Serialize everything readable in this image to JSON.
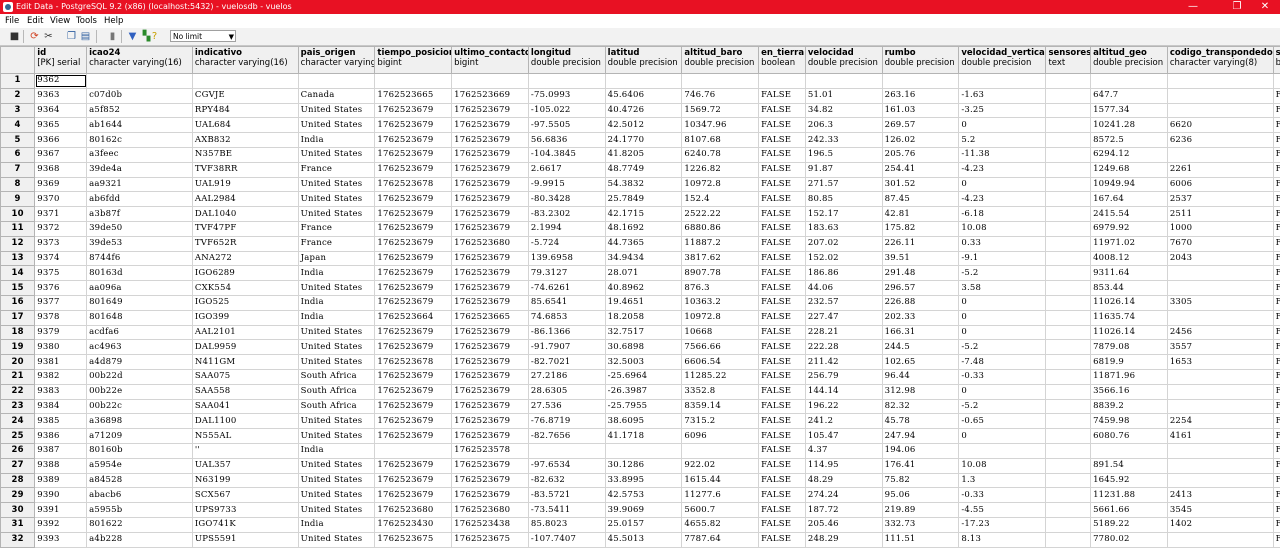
{
  "window": {
    "title": "Edit Data - PostgreSQL 9.2 (x86) (localhost:5432) - vuelosdb - vuelos",
    "minimize": "—",
    "maximize": "❐",
    "close": "✕"
  },
  "menu": [
    "File",
    "Edit",
    "View",
    "Tools",
    "Help"
  ],
  "toolbar": {
    "limit": "No limit"
  },
  "columns": [
    {
      "name": "id",
      "type": "[PK] serial"
    },
    {
      "name": "icao24",
      "type": "character varying(16)"
    },
    {
      "name": "indicativo",
      "type": "character varying(16)"
    },
    {
      "name": "pais_origen",
      "type": "character varying(64)"
    },
    {
      "name": "tiempo_posicion",
      "type": "bigint"
    },
    {
      "name": "ultimo_contacto",
      "type": "bigint"
    },
    {
      "name": "longitud",
      "type": "double precision"
    },
    {
      "name": "latitud",
      "type": "double precision"
    },
    {
      "name": "altitud_baro",
      "type": "double precision"
    },
    {
      "name": "en_tierra",
      "type": "boolean"
    },
    {
      "name": "velocidad",
      "type": "double precision"
    },
    {
      "name": "rumbo",
      "type": "double precision"
    },
    {
      "name": "velocidad_vertical",
      "type": "double precision"
    },
    {
      "name": "sensores",
      "type": "text"
    },
    {
      "name": "altitud_geo",
      "type": "double precision"
    },
    {
      "name": "codigo_transpondedor",
      "type": "character varying(8)"
    },
    {
      "name": "spi",
      "type": "bool"
    }
  ],
  "rows": [
    [
      "9362",
      "",
      "",
      "",
      "",
      "",
      "",
      "",
      "",
      "",
      "",
      "",
      "",
      "",
      "",
      "",
      ""
    ],
    [
      "9363",
      "c07d0b",
      "CGVJE",
      "Canada",
      "1762523665",
      "1762523669",
      "-75.0993",
      "45.6406",
      "746.76",
      "FALSE",
      "51.01",
      "263.16",
      "-1.63",
      "",
      "647.7",
      "",
      "FAL"
    ],
    [
      "9364",
      "a5f852",
      "RPY484",
      "United States",
      "1762523679",
      "1762523679",
      "-105.022",
      "40.4726",
      "1569.72",
      "FALSE",
      "34.82",
      "161.03",
      "-3.25",
      "",
      "1577.34",
      "",
      "FAL"
    ],
    [
      "9365",
      "ab1644",
      "UAL684",
      "United States",
      "1762523679",
      "1762523679",
      "-97.5505",
      "42.5012",
      "10347.96",
      "FALSE",
      "206.3",
      "269.57",
      "0",
      "",
      "10241.28",
      "6620",
      "FAL"
    ],
    [
      "9366",
      "80162c",
      "AXB832",
      "India",
      "1762523679",
      "1762523679",
      "56.6836",
      "24.1770",
      "8107.68",
      "FALSE",
      "242.33",
      "126.02",
      "5.2",
      "",
      "8572.5",
      "6236",
      "FAL"
    ],
    [
      "9367",
      "a3feec",
      "N357BE",
      "United States",
      "1762523679",
      "1762523679",
      "-104.3845",
      "41.8205",
      "6240.78",
      "FALSE",
      "196.5",
      "205.76",
      "-11.38",
      "",
      "6294.12",
      "",
      "FAL"
    ],
    [
      "9368",
      "39de4a",
      "TVF38RR",
      "France",
      "1762523679",
      "1762523679",
      "2.6617",
      "48.7749",
      "1226.82",
      "FALSE",
      "91.87",
      "254.41",
      "-4.23",
      "",
      "1249.68",
      "2261",
      "FAL"
    ],
    [
      "9369",
      "aa9321",
      "UAL919",
      "United States",
      "1762523678",
      "1762523679",
      "-9.9915",
      "54.3832",
      "10972.8",
      "FALSE",
      "271.57",
      "301.52",
      "0",
      "",
      "10949.94",
      "6006",
      "FAL"
    ],
    [
      "9370",
      "ab6fdd",
      "AAL2984",
      "United States",
      "1762523679",
      "1762523679",
      "-80.3428",
      "25.7849",
      "152.4",
      "FALSE",
      "80.85",
      "87.45",
      "-4.23",
      "",
      "167.64",
      "2537",
      "FAL"
    ],
    [
      "9371",
      "a3b87f",
      "DAL1040",
      "United States",
      "1762523679",
      "1762523679",
      "-83.2302",
      "42.1715",
      "2522.22",
      "FALSE",
      "152.17",
      "42.81",
      "-6.18",
      "",
      "2415.54",
      "2511",
      "FAL"
    ],
    [
      "9372",
      "39de50",
      "TVF47PF",
      "France",
      "1762523679",
      "1762523679",
      "2.1994",
      "48.1692",
      "6880.86",
      "FALSE",
      "183.63",
      "175.82",
      "10.08",
      "",
      "6979.92",
      "1000",
      "FAL"
    ],
    [
      "9373",
      "39de53",
      "TVF652R",
      "France",
      "1762523679",
      "1762523680",
      "-5.724",
      "44.7365",
      "11887.2",
      "FALSE",
      "207.02",
      "226.11",
      "0.33",
      "",
      "11971.02",
      "7670",
      "FAL"
    ],
    [
      "9374",
      "8744f6",
      "ANA272",
      "Japan",
      "1762523679",
      "1762523679",
      "139.6958",
      "34.9434",
      "3817.62",
      "FALSE",
      "152.02",
      "39.51",
      "-9.1",
      "",
      "4008.12",
      "2043",
      "FAL"
    ],
    [
      "9375",
      "80163d",
      "IGO6289",
      "India",
      "1762523679",
      "1762523679",
      "79.3127",
      "28.071",
      "8907.78",
      "FALSE",
      "186.86",
      "291.48",
      "-5.2",
      "",
      "9311.64",
      "",
      "FAL"
    ],
    [
      "9376",
      "aa096a",
      "CXK554",
      "United States",
      "1762523679",
      "1762523679",
      "-74.6261",
      "40.8962",
      "876.3",
      "FALSE",
      "44.06",
      "296.57",
      "3.58",
      "",
      "853.44",
      "",
      "FAL"
    ],
    [
      "9377",
      "801649",
      "IGO525",
      "India",
      "1762523679",
      "1762523679",
      "85.6541",
      "19.4651",
      "10363.2",
      "FALSE",
      "232.57",
      "226.88",
      "0",
      "",
      "11026.14",
      "3305",
      "FAL"
    ],
    [
      "9378",
      "801648",
      "IGO399",
      "India",
      "1762523664",
      "1762523665",
      "74.6853",
      "18.2058",
      "10972.8",
      "FALSE",
      "227.47",
      "202.33",
      "0",
      "",
      "11635.74",
      "",
      "FAL"
    ],
    [
      "9379",
      "acdfa6",
      "AAL2101",
      "United States",
      "1762523679",
      "1762523679",
      "-86.1366",
      "32.7517",
      "10668",
      "FALSE",
      "228.21",
      "166.31",
      "0",
      "",
      "11026.14",
      "2456",
      "FAL"
    ],
    [
      "9380",
      "ac4963",
      "DAL9959",
      "United States",
      "1762523679",
      "1762523679",
      "-91.7907",
      "30.6898",
      "7566.66",
      "FALSE",
      "222.28",
      "244.5",
      "-5.2",
      "",
      "7879.08",
      "3557",
      "FAL"
    ],
    [
      "9381",
      "a4d879",
      "N411GM",
      "United States",
      "1762523678",
      "1762523679",
      "-82.7021",
      "32.5003",
      "6606.54",
      "FALSE",
      "211.42",
      "102.65",
      "-7.48",
      "",
      "6819.9",
      "1653",
      "FAL"
    ],
    [
      "9382",
      "00b22d",
      "SAA075",
      "South Africa",
      "1762523679",
      "1762523679",
      "27.2186",
      "-25.6964",
      "11285.22",
      "FALSE",
      "256.79",
      "96.44",
      "-0.33",
      "",
      "11871.96",
      "",
      "FAL"
    ],
    [
      "9383",
      "00b22e",
      "SAA558",
      "South Africa",
      "1762523679",
      "1762523679",
      "28.6305",
      "-26.3987",
      "3352.8",
      "FALSE",
      "144.14",
      "312.98",
      "0",
      "",
      "3566.16",
      "",
      "FAL"
    ],
    [
      "9384",
      "00b22c",
      "SAA041",
      "South Africa",
      "1762523679",
      "1762523679",
      "27.536",
      "-25.7955",
      "8359.14",
      "FALSE",
      "196.22",
      "82.32",
      "-5.2",
      "",
      "8839.2",
      "",
      "FAL"
    ],
    [
      "9385",
      "a36898",
      "DAL1100",
      "United States",
      "1762523679",
      "1762523679",
      "-76.8719",
      "38.6095",
      "7315.2",
      "FALSE",
      "241.2",
      "45.78",
      "-0.65",
      "",
      "7459.98",
      "2254",
      "FAL"
    ],
    [
      "9386",
      "a71209",
      "N555AL",
      "United States",
      "1762523679",
      "1762523679",
      "-82.7656",
      "41.1718",
      "6096",
      "FALSE",
      "105.47",
      "247.94",
      "0",
      "",
      "6080.76",
      "4161",
      "FAL"
    ],
    [
      "9387",
      "80160b",
      "''",
      "India",
      "",
      "1762523578",
      "",
      "",
      "",
      "FALSE",
      "4.37",
      "194.06",
      "",
      "",
      "",
      "",
      "FAL"
    ],
    [
      "9388",
      "a5954e",
      "UAL357",
      "United States",
      "1762523679",
      "1762523679",
      "-97.6534",
      "30.1286",
      "922.02",
      "FALSE",
      "114.95",
      "176.41",
      "10.08",
      "",
      "891.54",
      "",
      "FAL"
    ],
    [
      "9389",
      "a84528",
      "N63199",
      "United States",
      "1762523679",
      "1762523679",
      "-82.632",
      "33.8995",
      "1615.44",
      "FALSE",
      "48.29",
      "75.82",
      "1.3",
      "",
      "1645.92",
      "",
      "FAL"
    ],
    [
      "9390",
      "abacb6",
      "SCX567",
      "United States",
      "1762523679",
      "1762523679",
      "-83.5721",
      "42.5753",
      "11277.6",
      "FALSE",
      "274.24",
      "95.06",
      "-0.33",
      "",
      "11231.88",
      "2413",
      "FAL"
    ],
    [
      "9391",
      "a5955b",
      "UPS9733",
      "United States",
      "1762523680",
      "1762523680",
      "-73.5411",
      "39.9069",
      "5600.7",
      "FALSE",
      "187.72",
      "219.89",
      "-4.55",
      "",
      "5661.66",
      "3545",
      "FAL"
    ],
    [
      "9392",
      "801622",
      "IGO741K",
      "India",
      "1762523430",
      "1762523438",
      "85.8023",
      "25.0157",
      "4655.82",
      "FALSE",
      "205.46",
      "332.73",
      "-17.23",
      "",
      "5189.22",
      "1402",
      "FAL"
    ],
    [
      "9393",
      "a4b228",
      "UPS5591",
      "United States",
      "1762523675",
      "1762523675",
      "-107.7407",
      "45.5013",
      "7787.64",
      "FALSE",
      "248.29",
      "111.51",
      "8.13",
      "",
      "7780.02",
      "",
      "FAL"
    ]
  ]
}
